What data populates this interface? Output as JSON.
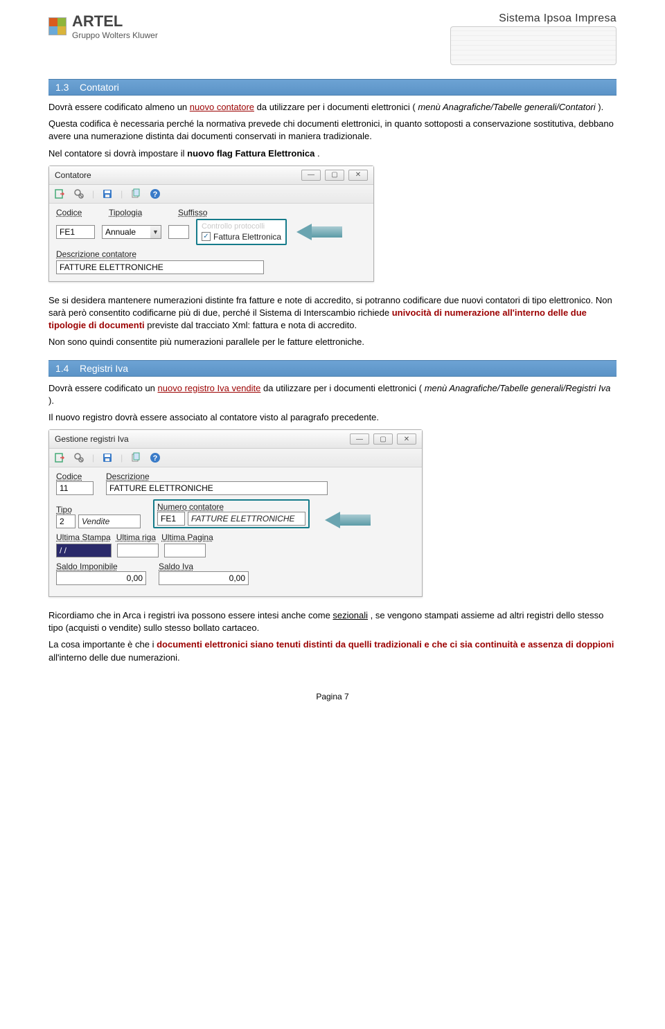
{
  "header": {
    "brand": "ARTEL",
    "subbrand": "Gruppo Wolters Kluwer",
    "system": "Sistema Ipsoa Impresa"
  },
  "sections": {
    "s1": {
      "num": "1.3",
      "title": "Contatori"
    },
    "s2": {
      "num": "1.4",
      "title": "Registri Iva"
    }
  },
  "para": {
    "p1a": "Dovrà essere codificato almeno un ",
    "p1b": "nuovo contatore",
    "p1c": " da utilizzare per i documenti elettronici (",
    "p1d": "menù Anagrafiche/Tabelle generali/Contatori",
    "p1e": ").",
    "p2": "Questa codifica è necessaria perché la normativa prevede chi documenti elettronici, in quanto sottoposti a conservazione sostitutiva, debbano avere una numerazione distinta dai documenti conservati in maniera tradizionale.",
    "p3a": "Nel contatore si dovrà impostare il ",
    "p3b": "nuovo flag Fattura Elettronica",
    "p3c": ".",
    "p4a": "Se si desidera mantenere numerazioni distinte fra fatture e note di accredito, si potranno codificare due nuovi contatori di tipo elettronico. Non sarà però consentito codificarne più di due, perché il Sistema di Interscambio richiede ",
    "p4b": "univocità di numerazione all'interno delle due tipologie di documenti",
    "p4c": " previste dal tracciato Xml: fattura e nota di accredito.",
    "p5": "Non sono quindi consentite più numerazioni parallele per le fatture elettroniche.",
    "p6a": "Dovrà essere codificato un ",
    "p6b": "nuovo registro Iva vendite",
    "p6c": " da utilizzare per i documenti elettronici (",
    "p6d": "menù Anagrafiche/Tabelle generali/Registri Iva",
    "p6e": ").",
    "p7": "Il nuovo registro dovrà essere associato al contatore visto al paragrafo precedente.",
    "p8a": "Ricordiamo che in Arca i registri iva possono essere intesi anche come ",
    "p8b": "sezionali",
    "p8c": ", se vengono stampati assieme ad altri registri dello stesso tipo (acquisti o vendite) sullo stesso bollato cartaceo.",
    "p9a": "La cosa importante è che i ",
    "p9b": "documenti elettronici siano tenuti distinti da quelli tradizionali e che ci sia continuità e assenza di doppioni",
    "p9c": " all'interno delle due numerazioni."
  },
  "win1": {
    "title": "Contatore",
    "labels": {
      "codice": "Codice",
      "tipologia": "Tipologia",
      "suffisso": "Suffisso",
      "descr": "Descrizione contatore"
    },
    "values": {
      "codice": "FE1",
      "tipologia": "Annuale",
      "descr": "FATTURE ELETTRONICHE"
    },
    "check": {
      "ghost": "Controllo protocolli",
      "flag": "Fattura Elettronica"
    }
  },
  "win2": {
    "title": "Gestione registri Iva",
    "labels": {
      "codice": "Codice",
      "descr": "Descrizione",
      "tipo": "Tipo",
      "numcont": "Numero contatore",
      "ultstampa": "Ultima Stampa",
      "ultriga": "Ultima riga",
      "ultpag": "Ultima Pagina",
      "saldoimp": "Saldo Imponibile",
      "saldoiva": "Saldo Iva"
    },
    "values": {
      "codice": "11",
      "descr": "FATTURE ELETTRONICHE",
      "tipo_code": "2",
      "tipo_name": "Vendite",
      "numcont_code": "FE1",
      "numcont_name": "FATTURE ELETTRONICHE",
      "ultstampa": "/ /",
      "saldoimp": "0,00",
      "saldoiva": "0,00"
    }
  },
  "footer": "Pagina 7"
}
